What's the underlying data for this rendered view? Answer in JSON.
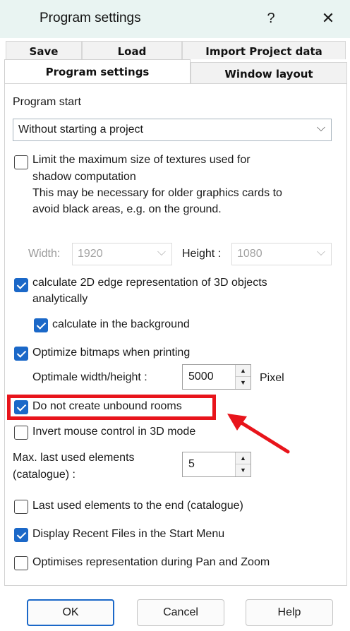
{
  "window": {
    "title": "Program settings",
    "help_glyph": "?",
    "close_glyph": "✕"
  },
  "tabs": {
    "save": "Save",
    "load": "Load",
    "import": "Import Project data",
    "program_settings": "Program settings",
    "window_layout": "Window layout"
  },
  "program_start": {
    "label": "Program start",
    "selected": "Without starting a project"
  },
  "textures": {
    "checked": false,
    "line1": "Limit the maximum size of textures used for",
    "line2": "shadow computation",
    "line3": "This may be necessary for older graphics cards to",
    "line4": "avoid black areas, e.g. on the ground.",
    "width_label": "Width:",
    "width_value": "1920",
    "height_label": "Height :",
    "height_value": "1080"
  },
  "edge_representation": {
    "checked": true,
    "line1": "calculate 2D edge representation of 3D objects",
    "line2": "analytically",
    "background_checked": true,
    "background_label": "calculate in the background"
  },
  "bitmaps": {
    "checked": true,
    "label": "Optimize bitmaps when printing",
    "size_label": "Optimale width/height :",
    "size_value": "5000",
    "unit": "Pixel"
  },
  "unbound_rooms": {
    "checked": true,
    "label": "Do not create unbound rooms"
  },
  "invert_mouse": {
    "checked": false,
    "label": "Invert mouse control in 3D mode"
  },
  "last_used": {
    "line1": "Max. last used elements",
    "line2": "(catalogue) :",
    "value": "5"
  },
  "last_used_end": {
    "checked": false,
    "label": "Last used elements to the end (catalogue)"
  },
  "recent_files": {
    "checked": true,
    "label": "Display Recent Files in the Start Menu"
  },
  "pan_zoom": {
    "checked": false,
    "label": "Optimises representation during Pan and Zoom"
  },
  "buttons": {
    "ok": "OK",
    "cancel": "Cancel",
    "help": "Help"
  },
  "annotation": {
    "color": "#e8141b"
  }
}
